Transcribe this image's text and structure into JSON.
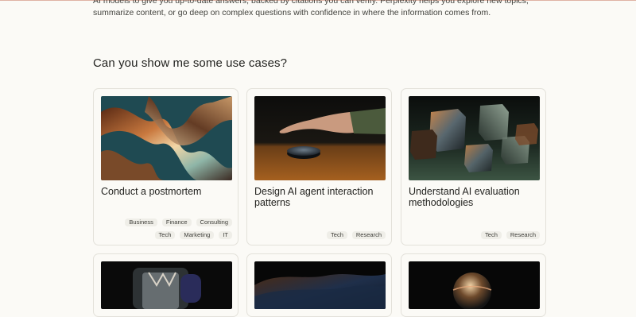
{
  "intro": {
    "line1": "AI models to give you up-to-date answers, backed by citations you can verify. Perplexity helps you explore new topics,",
    "line2": "summarize content, or go deep on complex questions with confidence in where the information comes from."
  },
  "section": {
    "heading": "Can you show me some use cases?"
  },
  "cards": [
    {
      "title": "Conduct a postmortem",
      "image": "iridescent-ribbon-image",
      "tags": [
        "Business",
        "Finance",
        "Consulting",
        "Tech",
        "Marketing",
        "IT"
      ]
    },
    {
      "title": "Design AI agent interaction patterns",
      "image": "hand-touching-disc-image",
      "tags": [
        "Tech",
        "Research"
      ]
    },
    {
      "title": "Understand AI evaluation methodologies",
      "image": "glass-cubes-image",
      "tags": [
        "Tech",
        "Research"
      ]
    }
  ],
  "more_cards": [
    {
      "image": "metal-mechanism-image"
    },
    {
      "image": "draped-fabric-image"
    },
    {
      "image": "glass-sphere-image"
    }
  ],
  "colors": {
    "background": "#fbfaf6",
    "card_border": "#e3e1da",
    "tag_background": "#efeee8",
    "top_rule": "#e0b3a4"
  }
}
